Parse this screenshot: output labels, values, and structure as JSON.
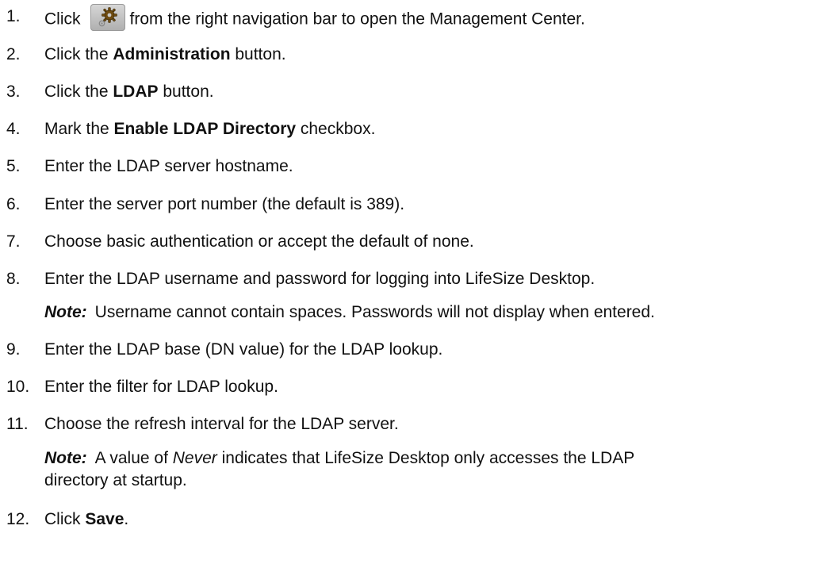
{
  "steps": [
    {
      "num": "1.",
      "before": "Click",
      "after": "from the right navigation bar to open the Management Center."
    },
    {
      "num": "2.",
      "before": "Click the ",
      "bold": "Administration",
      "after": " button."
    },
    {
      "num": "3.",
      "before": "Click the ",
      "bold": "LDAP",
      "after": " button."
    },
    {
      "num": "4.",
      "before": "Mark the ",
      "bold": "Enable LDAP Directory",
      "after": " checkbox."
    },
    {
      "num": "5.",
      "text": "Enter the LDAP server hostname."
    },
    {
      "num": "6.",
      "text": "Enter the server port number (the default is 389)."
    },
    {
      "num": "7.",
      "text": "Choose basic authentication or accept the default of none."
    },
    {
      "num": "8.",
      "text": "Enter the LDAP username and password for logging into LifeSize Desktop."
    },
    {
      "num": "9.",
      "text": "Enter the LDAP base (DN value) for the LDAP lookup."
    },
    {
      "num": "10.",
      "text": "Enter the filter for LDAP lookup."
    },
    {
      "num": "11.",
      "text": "Choose the refresh interval for the LDAP server."
    },
    {
      "num": "12.",
      "before": "Click ",
      "bold": "Save",
      "after": "."
    }
  ],
  "notes": {
    "label": "Note:",
    "note1": "Username cannot contain spaces. Passwords will not display when entered.",
    "note2_before": "A value of ",
    "note2_italic": "Never",
    "note2_after": " indicates that LifeSize Desktop only accesses the LDAP",
    "note2_line2": "directory at startup."
  },
  "icons": {
    "step1_icon": "gear-icon"
  }
}
